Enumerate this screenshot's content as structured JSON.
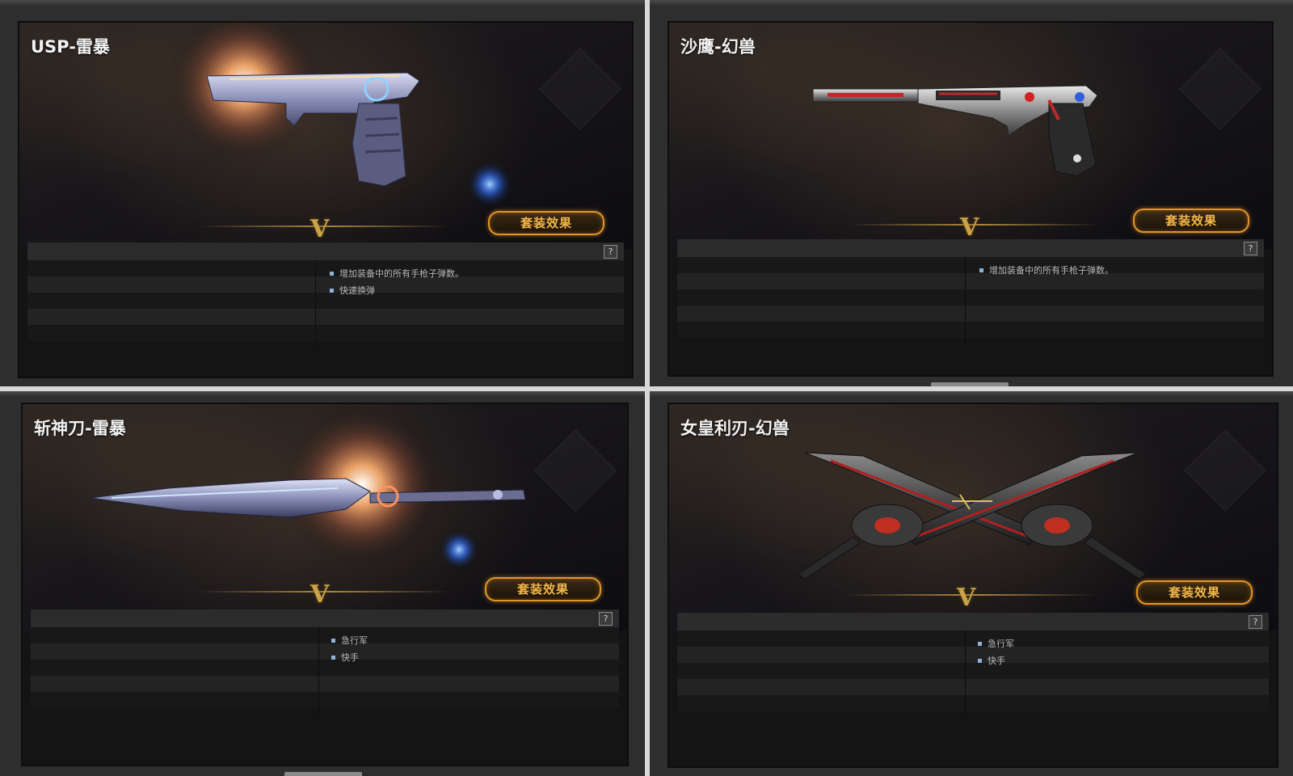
{
  "panels": [
    {
      "weapon_name": "USP-雷暴",
      "weapon_icon": "usp-pistol-icon",
      "set_effect_button": "套装效果",
      "divider_glyph": "V",
      "help_label": "?",
      "effects": [
        "增加装备中的所有手枪子弹数。",
        "快速换弹"
      ]
    },
    {
      "weapon_name": "沙鹰-幻兽",
      "weapon_icon": "desert-eagle-icon",
      "set_effect_button": "套装效果",
      "divider_glyph": "V",
      "help_label": "?",
      "effects": [
        "增加装备中的所有手枪子弹数。"
      ]
    },
    {
      "weapon_name": "斩神刀-雷暴",
      "weapon_icon": "blade-icon",
      "set_effect_button": "套装效果",
      "divider_glyph": "V",
      "help_label": "?",
      "effects": [
        "急行军",
        "快手"
      ]
    },
    {
      "weapon_name": "女皇利刃-幻兽",
      "weapon_icon": "crossed-blades-icon",
      "set_effect_button": "套装效果",
      "divider_glyph": "V",
      "help_label": "?",
      "effects": [
        "急行军",
        "快手"
      ]
    }
  ],
  "colors": {
    "accent": "#e0962a",
    "button_text": "#f2b64a",
    "divider_gold": "#c9a24a",
    "bullet": "#8fb4d9"
  }
}
